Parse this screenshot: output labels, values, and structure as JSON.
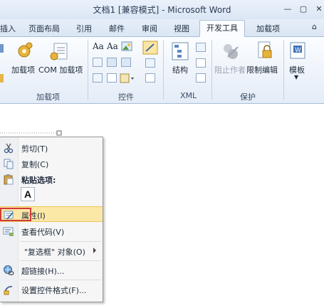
{
  "window": {
    "title": "文档1 [兼容模式] - Microsoft Word",
    "buttons": {
      "minimize": "—",
      "maximize": "▢",
      "close": "✕"
    }
  },
  "tabs": [
    "插入",
    "页面布局",
    "引用",
    "邮件",
    "审阅",
    "视图",
    "开发工具",
    "加载项"
  ],
  "active_tab": "开发工具",
  "help_icon": "⌂",
  "ribbon": {
    "addins_group": {
      "label": "加载项",
      "items": [
        "加载项",
        "COM 加载项"
      ]
    },
    "controls_group": {
      "label": "控件",
      "aa1": "Aa",
      "aa2": "Aa"
    },
    "xml_group": {
      "label": "XML",
      "items": [
        "结构"
      ]
    },
    "protect_group": {
      "label": "保护",
      "items": [
        "阻止作者",
        "限制编辑"
      ]
    },
    "templates_group": {
      "items": [
        "模板"
      ]
    }
  },
  "context_menu": {
    "items": [
      {
        "label": "剪切(T)",
        "icon": "scissors-icon"
      },
      {
        "label": "复制(C)",
        "icon": "copy-icon"
      },
      {
        "label": "粘贴选项:",
        "icon": "paste-icon"
      },
      {
        "label": "A",
        "icon": "paste-keep-text-icon"
      },
      {
        "label": "属性(I)",
        "icon": "properties-icon",
        "highlighted": true
      },
      {
        "label": "查看代码(V)",
        "icon": "view-code-icon"
      },
      {
        "label": "\"复选框\" 对象(O)",
        "icon": "submenu-arrow-icon"
      },
      {
        "label": "超链接(H)...",
        "icon": "hyperlink-icon"
      },
      {
        "label": "设置控件格式(F)...",
        "icon": "format-control-icon"
      }
    ]
  },
  "colors": {
    "highlight": "#fbe8a7",
    "annotation_box": "#d33b3b",
    "ribbon_border": "#a9bcd6"
  }
}
